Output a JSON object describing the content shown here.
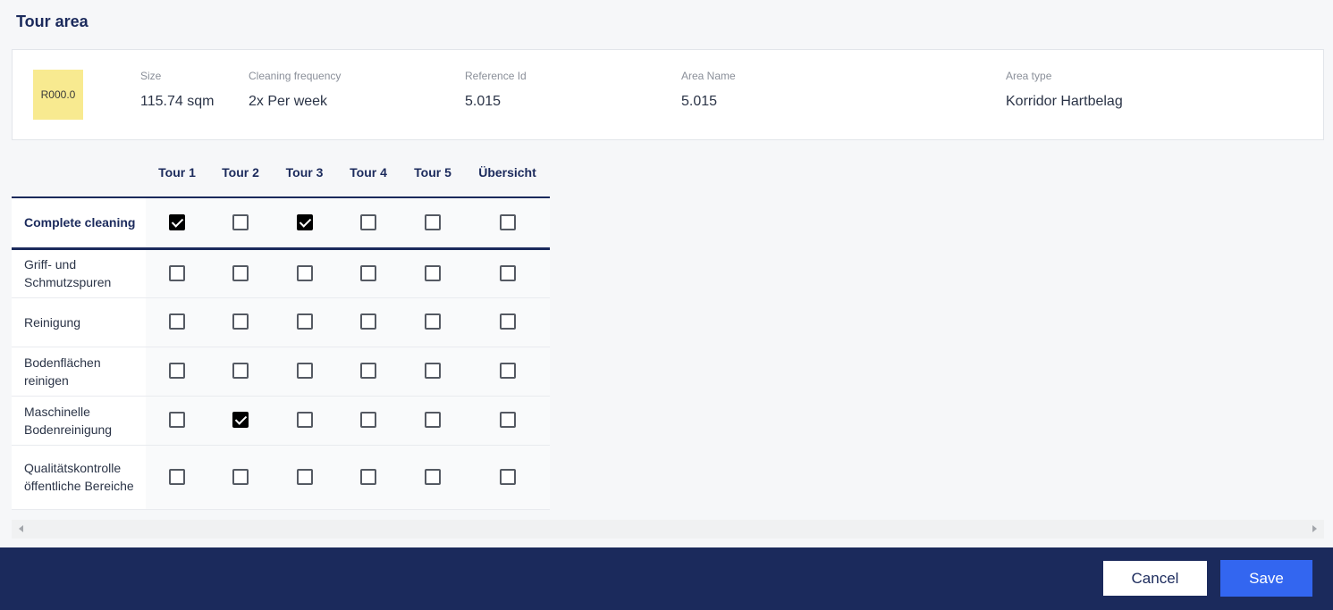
{
  "page": {
    "title": "Tour area"
  },
  "area": {
    "badge": "R000.0",
    "badge_color": "#f8ea90",
    "fields": [
      {
        "label": "Size",
        "value": "115.74 sqm"
      },
      {
        "label": "Cleaning frequency",
        "value": "2x Per week"
      },
      {
        "label": "Reference Id",
        "value": "5.015"
      },
      {
        "label": "Area Name",
        "value": "5.015"
      },
      {
        "label": "Area type",
        "value": "Korridor Hartbelag"
      }
    ]
  },
  "grid": {
    "columns": [
      "Tour 1",
      "Tour 2",
      "Tour 3",
      "Tour 4",
      "Tour 5",
      "Übersicht"
    ],
    "summary": {
      "label": "Complete cleaning",
      "checked": [
        true,
        false,
        true,
        false,
        false,
        false
      ]
    },
    "rows": [
      {
        "label": "Griff- und Schmutzspuren",
        "checked": [
          false,
          false,
          false,
          false,
          false,
          false
        ]
      },
      {
        "label": "Reinigung",
        "checked": [
          false,
          false,
          false,
          false,
          false,
          false
        ]
      },
      {
        "label": "Bodenflächen reinigen",
        "checked": [
          false,
          false,
          false,
          false,
          false,
          false
        ]
      },
      {
        "label": "Maschinelle Bodenreinigung",
        "checked": [
          false,
          true,
          false,
          false,
          false,
          false
        ]
      },
      {
        "label": "Qualitätskontrolle öffentliche Bereiche",
        "checked": [
          false,
          false,
          false,
          false,
          false,
          false
        ]
      }
    ]
  },
  "footer": {
    "cancel_label": "Cancel",
    "save_label": "Save"
  },
  "colors": {
    "primary": "#1b2a5c",
    "accent": "#3366f0"
  }
}
